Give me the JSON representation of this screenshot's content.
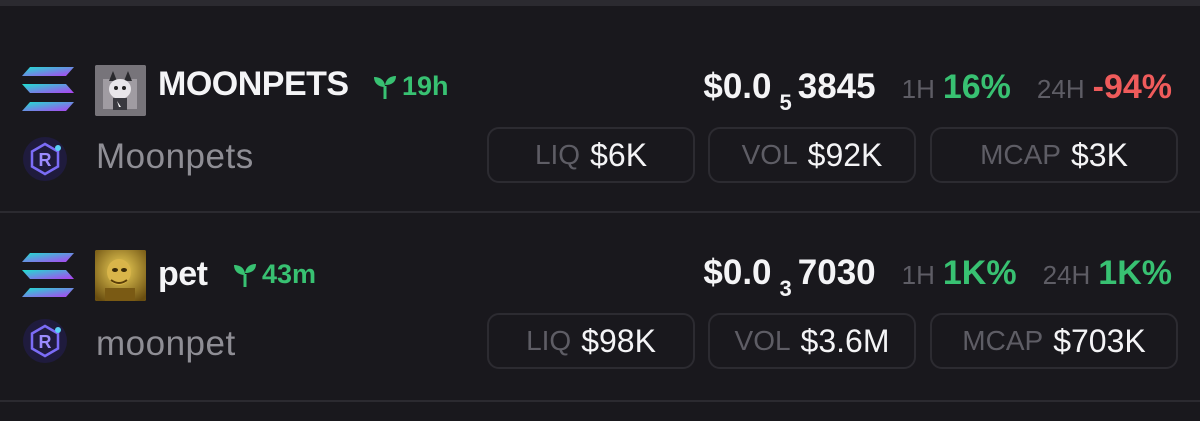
{
  "tokens": [
    {
      "symbol": "MOONPETS",
      "age": "19h",
      "name": "Moonpets",
      "price_main": "$0.0",
      "price_zeros": "5",
      "price_digits": "3845",
      "h1_label": "1H",
      "h1_value": "16%",
      "h1_dir": "pos",
      "h24_label": "24H",
      "h24_value": "-94%",
      "h24_dir": "neg",
      "liq_label": "LIQ",
      "liq_value": "$6K",
      "vol_label": "VOL",
      "vol_value": "$92K",
      "mcap_label": "MCAP",
      "mcap_value": "$3K"
    },
    {
      "symbol": "pet",
      "age": "43m",
      "name": "moonpet",
      "price_main": "$0.0",
      "price_zeros": "3",
      "price_digits": "7030",
      "h1_label": "1H",
      "h1_value": "1K%",
      "h1_dir": "pos",
      "h24_label": "24H",
      "h24_value": "1K%",
      "h24_dir": "pos",
      "liq_label": "LIQ",
      "liq_value": "$98K",
      "vol_label": "VOL",
      "vol_value": "$3.6M",
      "mcap_label": "MCAP",
      "mcap_value": "$703K"
    }
  ],
  "icons": {
    "chain": "solana-icon",
    "dex": "raydium-icon",
    "age": "seedling-icon"
  },
  "colors": {
    "background": "#19181d",
    "positive": "#38c172",
    "negative": "#ef5b5b",
    "muted": "#5e5d65"
  }
}
